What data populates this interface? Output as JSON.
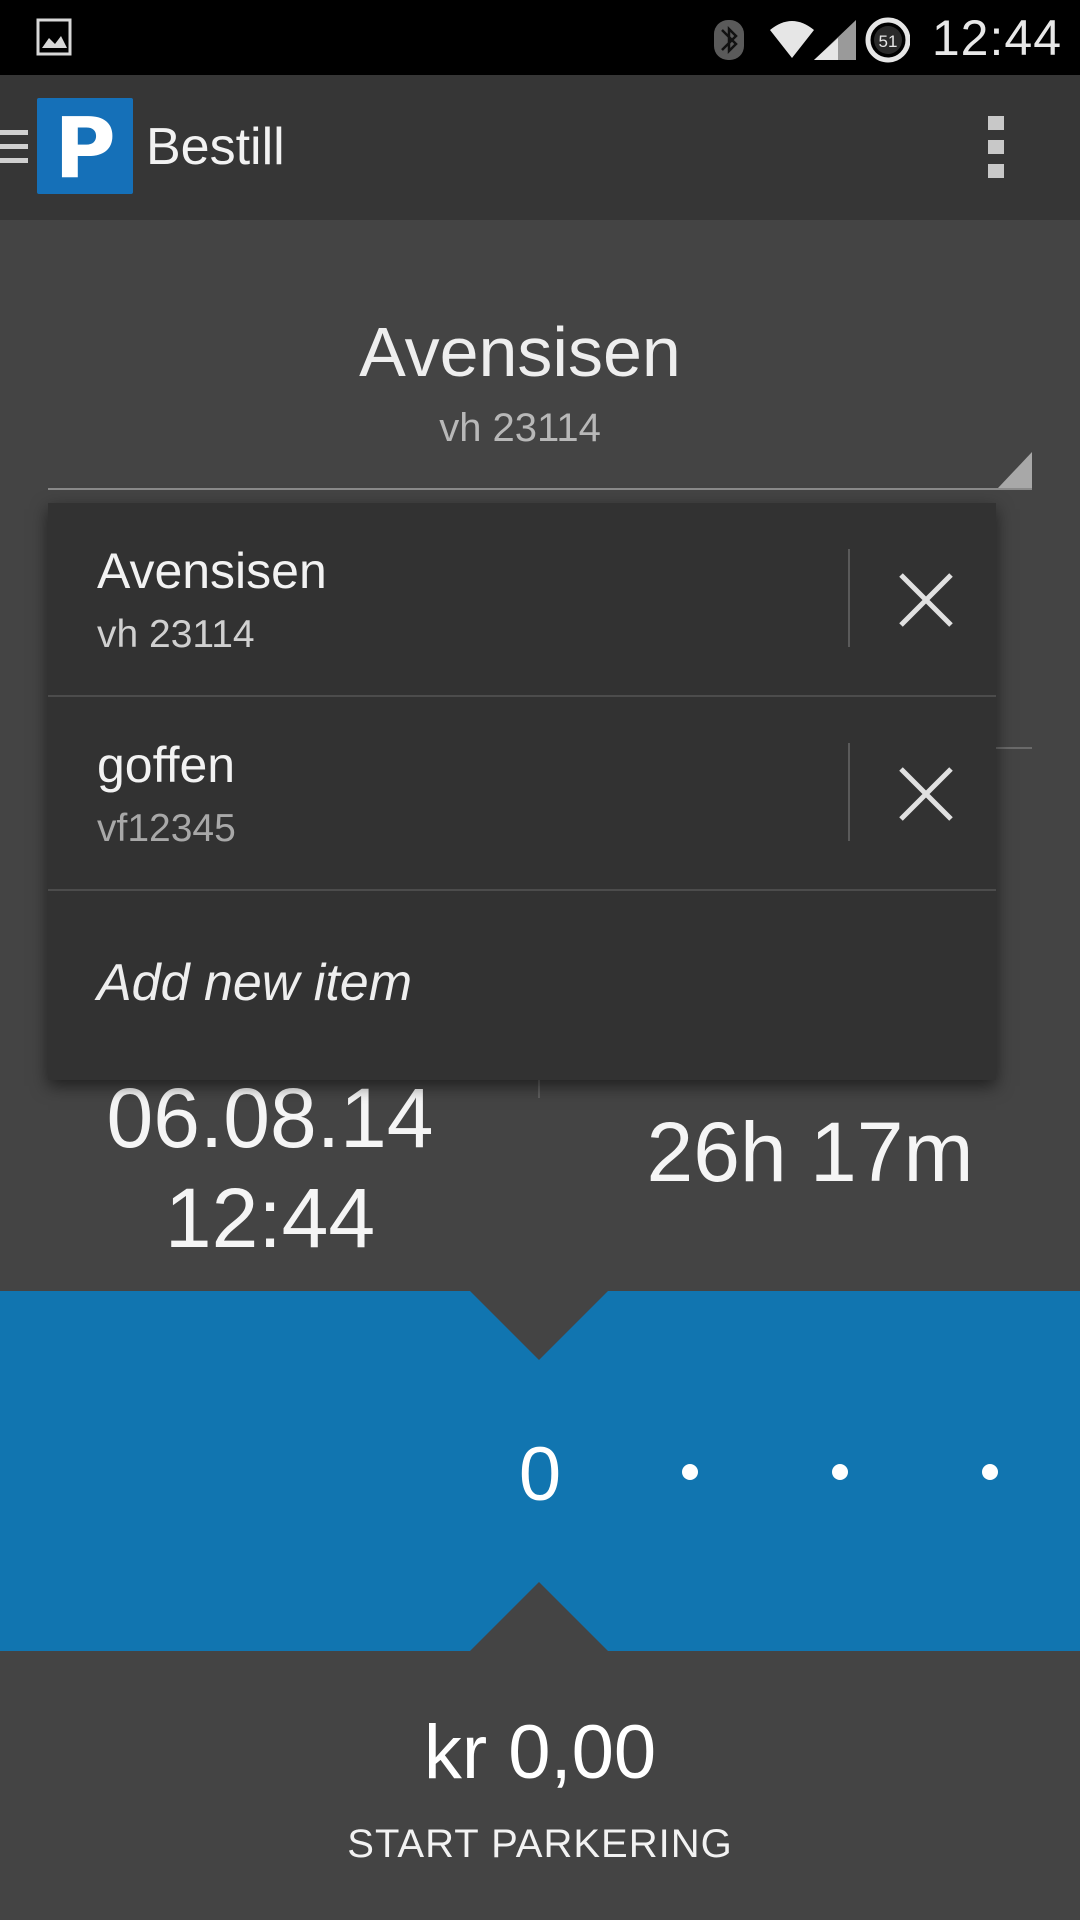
{
  "status_bar": {
    "time": "12:44",
    "battery_level": "51",
    "icons": [
      "image-icon",
      "bluetooth-icon",
      "wifi-icon",
      "signal-icon",
      "battery-icon"
    ]
  },
  "action_bar": {
    "title": "Bestill",
    "logo_letter": "P",
    "colors": {
      "background": "#363636",
      "logo": "#1570b8"
    }
  },
  "spinner": {
    "selected_name": "Avensisen",
    "selected_plate": "vh 23114"
  },
  "dropdown": {
    "items": [
      {
        "name": "Avensisen",
        "plate": "vh 23114"
      },
      {
        "name": "goffen",
        "plate": "vf12345"
      }
    ],
    "add_label": "Add new item"
  },
  "parking": {
    "start_date": "06.08.14",
    "start_time": "12:44",
    "duration": "26h 17m",
    "selector_value": "0",
    "price": "kr 0,00",
    "start_button": "START PARKERING",
    "colors": {
      "band": "#1175b0",
      "background": "#444444"
    }
  }
}
